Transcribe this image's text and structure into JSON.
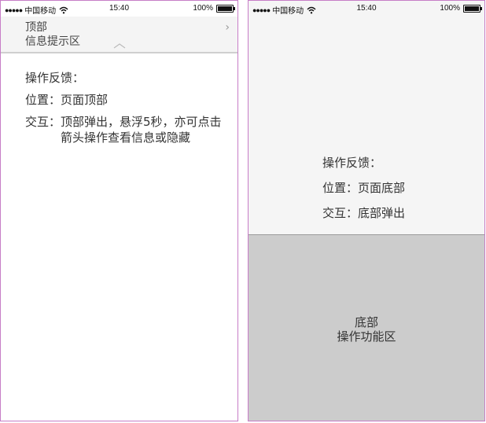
{
  "statusbar": {
    "signal_dots": "●●●●●",
    "carrier": "中国移动",
    "time": "15:40",
    "battery_text": "100%",
    "battery_level": 1.0
  },
  "left_phone": {
    "banner": {
      "line1": "顶部",
      "line2": "信息提示区",
      "expand_icon": "chevron-right-icon",
      "collapse_icon": "chevron-up-icon"
    },
    "feedback_title": "操作反馈：",
    "position_label": "位置：",
    "position_value": "页面顶部",
    "interaction_label": "交互：",
    "interaction_value": "顶部弹出，悬浮5秒，亦可点击箭头操作查看信息或隐藏"
  },
  "right_phone": {
    "feedback_title": "操作反馈：",
    "position_label": "位置：",
    "position_value": "页面底部",
    "interaction_label": "交互：",
    "interaction_value": "底部弹出",
    "bottom": {
      "line1": "底部",
      "line2": "操作功能区"
    }
  },
  "colors": {
    "frame": "#c77dc7",
    "banner_bg": "#f4f4f4",
    "bottom_bg": "#cccccc"
  }
}
